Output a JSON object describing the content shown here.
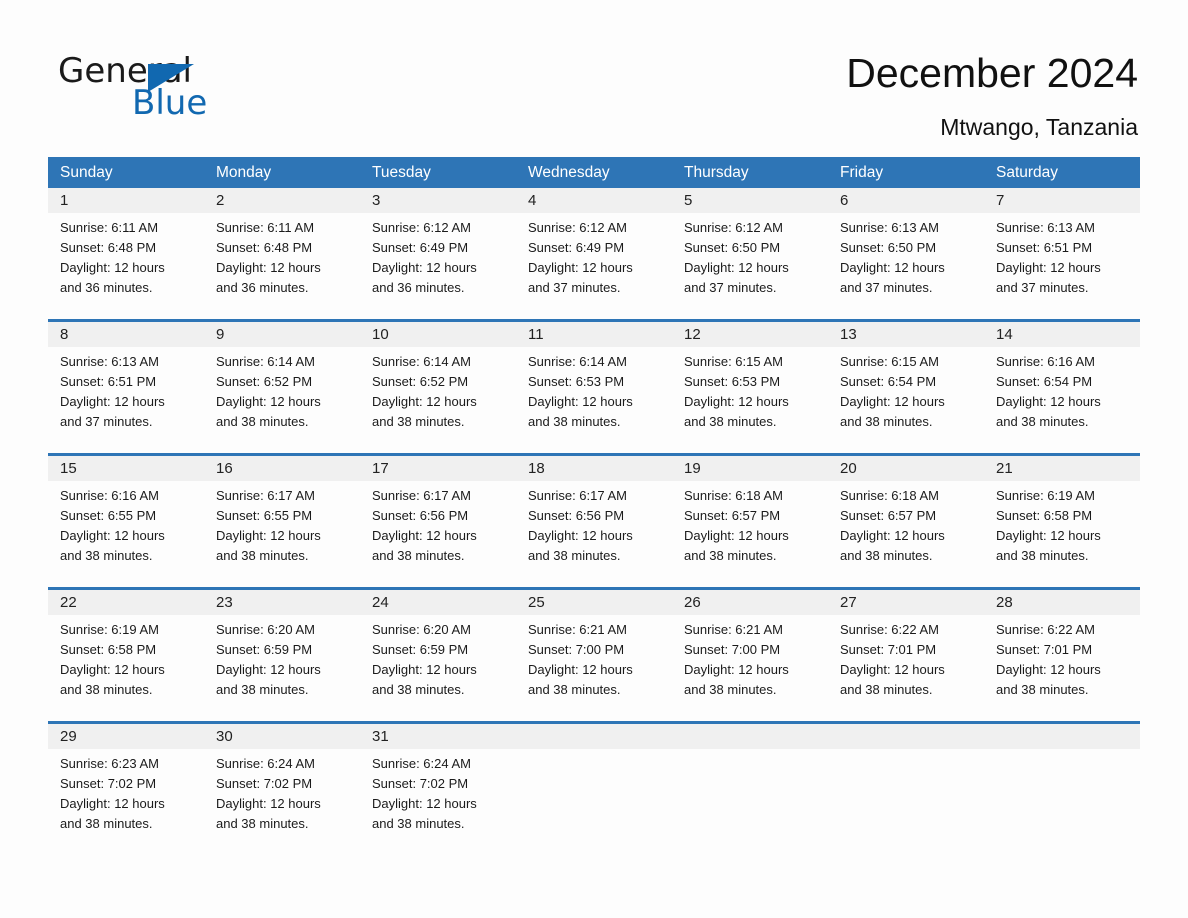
{
  "brand": {
    "name_part1": "General",
    "name_part2": "Blue",
    "triangle_color": "#1168b0",
    "text_color": "#1a1a1a"
  },
  "header": {
    "title": "December 2024",
    "subtitle": "Mtwango, Tanzania"
  },
  "theme": {
    "header_blue": "#2e75b6",
    "rule_blue": "#2e75b6",
    "date_band_gray": "#f0f0f0",
    "page_background": "#fdfdfd"
  },
  "weekdays": [
    "Sunday",
    "Monday",
    "Tuesday",
    "Wednesday",
    "Thursday",
    "Friday",
    "Saturday"
  ],
  "weeks": [
    [
      {
        "day": "1",
        "sunrise": "Sunrise: 6:11 AM",
        "sunset": "Sunset: 6:48 PM",
        "daylight_line1": "Daylight: 12 hours",
        "daylight_line2": "and 36 minutes."
      },
      {
        "day": "2",
        "sunrise": "Sunrise: 6:11 AM",
        "sunset": "Sunset: 6:48 PM",
        "daylight_line1": "Daylight: 12 hours",
        "daylight_line2": "and 36 minutes."
      },
      {
        "day": "3",
        "sunrise": "Sunrise: 6:12 AM",
        "sunset": "Sunset: 6:49 PM",
        "daylight_line1": "Daylight: 12 hours",
        "daylight_line2": "and 36 minutes."
      },
      {
        "day": "4",
        "sunrise": "Sunrise: 6:12 AM",
        "sunset": "Sunset: 6:49 PM",
        "daylight_line1": "Daylight: 12 hours",
        "daylight_line2": "and 37 minutes."
      },
      {
        "day": "5",
        "sunrise": "Sunrise: 6:12 AM",
        "sunset": "Sunset: 6:50 PM",
        "daylight_line1": "Daylight: 12 hours",
        "daylight_line2": "and 37 minutes."
      },
      {
        "day": "6",
        "sunrise": "Sunrise: 6:13 AM",
        "sunset": "Sunset: 6:50 PM",
        "daylight_line1": "Daylight: 12 hours",
        "daylight_line2": "and 37 minutes."
      },
      {
        "day": "7",
        "sunrise": "Sunrise: 6:13 AM",
        "sunset": "Sunset: 6:51 PM",
        "daylight_line1": "Daylight: 12 hours",
        "daylight_line2": "and 37 minutes."
      }
    ],
    [
      {
        "day": "8",
        "sunrise": "Sunrise: 6:13 AM",
        "sunset": "Sunset: 6:51 PM",
        "daylight_line1": "Daylight: 12 hours",
        "daylight_line2": "and 37 minutes."
      },
      {
        "day": "9",
        "sunrise": "Sunrise: 6:14 AM",
        "sunset": "Sunset: 6:52 PM",
        "daylight_line1": "Daylight: 12 hours",
        "daylight_line2": "and 38 minutes."
      },
      {
        "day": "10",
        "sunrise": "Sunrise: 6:14 AM",
        "sunset": "Sunset: 6:52 PM",
        "daylight_line1": "Daylight: 12 hours",
        "daylight_line2": "and 38 minutes."
      },
      {
        "day": "11",
        "sunrise": "Sunrise: 6:14 AM",
        "sunset": "Sunset: 6:53 PM",
        "daylight_line1": "Daylight: 12 hours",
        "daylight_line2": "and 38 minutes."
      },
      {
        "day": "12",
        "sunrise": "Sunrise: 6:15 AM",
        "sunset": "Sunset: 6:53 PM",
        "daylight_line1": "Daylight: 12 hours",
        "daylight_line2": "and 38 minutes."
      },
      {
        "day": "13",
        "sunrise": "Sunrise: 6:15 AM",
        "sunset": "Sunset: 6:54 PM",
        "daylight_line1": "Daylight: 12 hours",
        "daylight_line2": "and 38 minutes."
      },
      {
        "day": "14",
        "sunrise": "Sunrise: 6:16 AM",
        "sunset": "Sunset: 6:54 PM",
        "daylight_line1": "Daylight: 12 hours",
        "daylight_line2": "and 38 minutes."
      }
    ],
    [
      {
        "day": "15",
        "sunrise": "Sunrise: 6:16 AM",
        "sunset": "Sunset: 6:55 PM",
        "daylight_line1": "Daylight: 12 hours",
        "daylight_line2": "and 38 minutes."
      },
      {
        "day": "16",
        "sunrise": "Sunrise: 6:17 AM",
        "sunset": "Sunset: 6:55 PM",
        "daylight_line1": "Daylight: 12 hours",
        "daylight_line2": "and 38 minutes."
      },
      {
        "day": "17",
        "sunrise": "Sunrise: 6:17 AM",
        "sunset": "Sunset: 6:56 PM",
        "daylight_line1": "Daylight: 12 hours",
        "daylight_line2": "and 38 minutes."
      },
      {
        "day": "18",
        "sunrise": "Sunrise: 6:17 AM",
        "sunset": "Sunset: 6:56 PM",
        "daylight_line1": "Daylight: 12 hours",
        "daylight_line2": "and 38 minutes."
      },
      {
        "day": "19",
        "sunrise": "Sunrise: 6:18 AM",
        "sunset": "Sunset: 6:57 PM",
        "daylight_line1": "Daylight: 12 hours",
        "daylight_line2": "and 38 minutes."
      },
      {
        "day": "20",
        "sunrise": "Sunrise: 6:18 AM",
        "sunset": "Sunset: 6:57 PM",
        "daylight_line1": "Daylight: 12 hours",
        "daylight_line2": "and 38 minutes."
      },
      {
        "day": "21",
        "sunrise": "Sunrise: 6:19 AM",
        "sunset": "Sunset: 6:58 PM",
        "daylight_line1": "Daylight: 12 hours",
        "daylight_line2": "and 38 minutes."
      }
    ],
    [
      {
        "day": "22",
        "sunrise": "Sunrise: 6:19 AM",
        "sunset": "Sunset: 6:58 PM",
        "daylight_line1": "Daylight: 12 hours",
        "daylight_line2": "and 38 minutes."
      },
      {
        "day": "23",
        "sunrise": "Sunrise: 6:20 AM",
        "sunset": "Sunset: 6:59 PM",
        "daylight_line1": "Daylight: 12 hours",
        "daylight_line2": "and 38 minutes."
      },
      {
        "day": "24",
        "sunrise": "Sunrise: 6:20 AM",
        "sunset": "Sunset: 6:59 PM",
        "daylight_line1": "Daylight: 12 hours",
        "daylight_line2": "and 38 minutes."
      },
      {
        "day": "25",
        "sunrise": "Sunrise: 6:21 AM",
        "sunset": "Sunset: 7:00 PM",
        "daylight_line1": "Daylight: 12 hours",
        "daylight_line2": "and 38 minutes."
      },
      {
        "day": "26",
        "sunrise": "Sunrise: 6:21 AM",
        "sunset": "Sunset: 7:00 PM",
        "daylight_line1": "Daylight: 12 hours",
        "daylight_line2": "and 38 minutes."
      },
      {
        "day": "27",
        "sunrise": "Sunrise: 6:22 AM",
        "sunset": "Sunset: 7:01 PM",
        "daylight_line1": "Daylight: 12 hours",
        "daylight_line2": "and 38 minutes."
      },
      {
        "day": "28",
        "sunrise": "Sunrise: 6:22 AM",
        "sunset": "Sunset: 7:01 PM",
        "daylight_line1": "Daylight: 12 hours",
        "daylight_line2": "and 38 minutes."
      }
    ],
    [
      {
        "day": "29",
        "sunrise": "Sunrise: 6:23 AM",
        "sunset": "Sunset: 7:02 PM",
        "daylight_line1": "Daylight: 12 hours",
        "daylight_line2": "and 38 minutes."
      },
      {
        "day": "30",
        "sunrise": "Sunrise: 6:24 AM",
        "sunset": "Sunset: 7:02 PM",
        "daylight_line1": "Daylight: 12 hours",
        "daylight_line2": "and 38 minutes."
      },
      {
        "day": "31",
        "sunrise": "Sunrise: 6:24 AM",
        "sunset": "Sunset: 7:02 PM",
        "daylight_line1": "Daylight: 12 hours",
        "daylight_line2": "and 38 minutes."
      },
      {
        "day": "",
        "sunrise": "",
        "sunset": "",
        "daylight_line1": "",
        "daylight_line2": ""
      },
      {
        "day": "",
        "sunrise": "",
        "sunset": "",
        "daylight_line1": "",
        "daylight_line2": ""
      },
      {
        "day": "",
        "sunrise": "",
        "sunset": "",
        "daylight_line1": "",
        "daylight_line2": ""
      },
      {
        "day": "",
        "sunrise": "",
        "sunset": "",
        "daylight_line1": "",
        "daylight_line2": ""
      }
    ]
  ]
}
